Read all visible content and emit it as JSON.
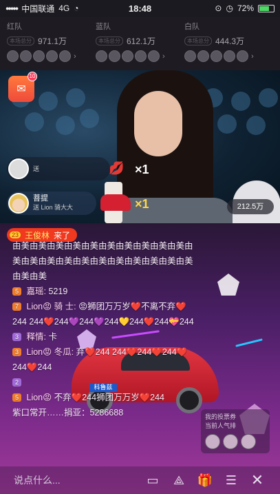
{
  "status": {
    "carrier": "中国联通",
    "network": "4G",
    "time": "18:48",
    "battery": "72%"
  },
  "teams": [
    {
      "name": "红队",
      "badge": "本场总分",
      "score": "971.1万"
    },
    {
      "name": "蓝队",
      "badge": "本场总分",
      "score": "612.1万"
    },
    {
      "name": "白队",
      "badge": "本场总分",
      "score": "444.3万"
    }
  ],
  "redpack": {
    "badge": "10"
  },
  "gifts": [
    {
      "sender": "",
      "desc": "送",
      "count": "×1"
    },
    {
      "sender": "菩提",
      "desc": "送 Lion 骑大大",
      "count": "×1"
    }
  ],
  "viewers": "212.5万",
  "entry": {
    "level": "23",
    "name": "王俊林",
    "action": "来了"
  },
  "chat": [
    {
      "badge": "",
      "badge_class": "",
      "name": "",
      "text": "由美由美由美由美由美由美由美由美由美由美由美由美由美由美由美由美由美由美由美由美由美由美由美"
    },
    {
      "badge": "5",
      "badge_class": "orange",
      "name": "嘉瑶:",
      "text": "5219"
    },
    {
      "badge": "7",
      "badge_class": "orange",
      "name": "Lion😡 骑 士:",
      "text": "😡狮团万万岁❤️不离不弃❤️244 244❤️244💜244💜244💛244❤️244💝244"
    },
    {
      "badge": "3",
      "badge_class": "purple",
      "name": "释情:",
      "text": "卡"
    },
    {
      "badge": "3",
      "badge_class": "orange",
      "name": "Lion😡 冬瓜:",
      "text": "弃❤️244 244❤️244❤️244❤️244❤️244"
    },
    {
      "badge": "2",
      "badge_class": "purple",
      "name": "",
      "text": ""
    },
    {
      "badge": "5",
      "badge_class": "orange",
      "name": "Lion😡",
      "text": "不弃❤️244狮团万万岁❤️244"
    },
    {
      "badge": "",
      "badge_class": "",
      "name": "",
      "text": "紫口常开……捐亚：5286688"
    }
  ],
  "rank": {
    "line1": "我的投票券",
    "line2": "当前人气排"
  },
  "bottom": {
    "placeholder": "说点什么..."
  },
  "car_plate": "科鲁兹"
}
